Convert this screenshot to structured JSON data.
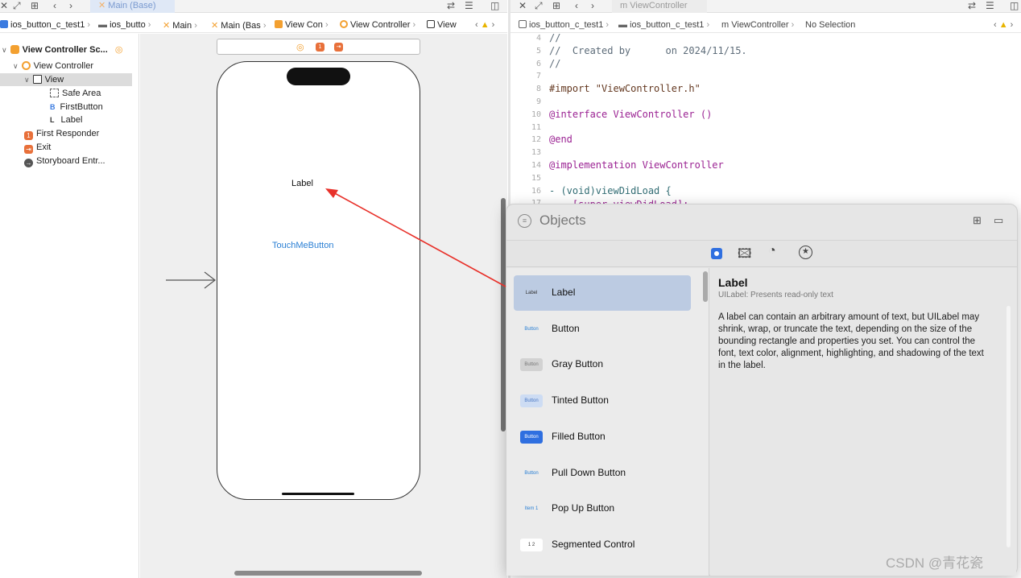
{
  "colors": {
    "selection": "#bccbe2",
    "link_blue": "#2a7fd4",
    "arrow_red": "#e8312a",
    "storyboard_orange": "#f0a030",
    "keyword": "#9b2393",
    "string": "#c41a16"
  },
  "left_tabbar": {
    "icons": [
      "close-icon",
      "expand-icon",
      "grid-icon",
      "back-icon",
      "forward-icon"
    ],
    "active_tab": "Main (Base)"
  },
  "right_tabbar": {
    "icons": [
      "close-icon",
      "expand-icon",
      "grid-icon",
      "back-icon",
      "forward-icon"
    ],
    "active_tab": "ViewController",
    "active_tab_prefix": "m"
  },
  "left_jumpbar": {
    "items": [
      "ios_button_c_test1",
      "ios_butto",
      "Main",
      "Main (Bas",
      "View Con",
      "View Controller",
      "View"
    ]
  },
  "right_jumpbar": {
    "items": [
      "ios_button_c_test1",
      "ios_button_c_test1",
      "ViewController",
      "No Selection"
    ],
    "file_prefix": "m"
  },
  "outline": {
    "scene": "View Controller Sc...",
    "controller": "View Controller",
    "view": "View",
    "safe_area": "Safe Area",
    "first_button": "FirstButton",
    "first_button_badge": "B",
    "label": "Label",
    "label_badge": "L",
    "first_responder": "First Responder",
    "exit": "Exit",
    "storyboard_entry": "Storyboard Entr..."
  },
  "canvas": {
    "label_text": "Label",
    "button_text": "TouchMeButton"
  },
  "editor": {
    "lines": [
      {
        "n": "4",
        "text": "//"
      },
      {
        "n": "5",
        "text": "//  Created by      on 2024/11/15."
      },
      {
        "n": "6",
        "text": "//"
      },
      {
        "n": "7",
        "text": ""
      },
      {
        "n": "8",
        "text": "#import \"ViewController.h\""
      },
      {
        "n": "9",
        "text": ""
      },
      {
        "n": "10",
        "text": "@interface ViewController ()"
      },
      {
        "n": "11",
        "text": ""
      },
      {
        "n": "12",
        "text": "@end"
      },
      {
        "n": "13",
        "text": ""
      },
      {
        "n": "14",
        "text": "@implementation ViewController"
      },
      {
        "n": "15",
        "text": ""
      },
      {
        "n": "16",
        "text": "- (void)viewDidLoad {"
      },
      {
        "n": "17",
        "text": "    [super viewDidLoad];"
      }
    ]
  },
  "library": {
    "title": "Objects",
    "filter_tabs": [
      "objects-icon",
      "image-icon",
      "palette-icon",
      "star-icon"
    ],
    "items": [
      {
        "label": "Label",
        "thumb": "Label"
      },
      {
        "label": "Button",
        "thumb": "Button"
      },
      {
        "label": "Gray Button",
        "thumb": "Button"
      },
      {
        "label": "Tinted Button",
        "thumb": "Button"
      },
      {
        "label": "Filled Button",
        "thumb": "Button"
      },
      {
        "label": "Pull Down Button",
        "thumb": "Button"
      },
      {
        "label": "Pop Up Button",
        "thumb": "Item 1"
      },
      {
        "label": "Segmented Control",
        "thumb": "1  2"
      }
    ],
    "detail": {
      "title": "Label",
      "subtitle": "UILabel: Presents read-only text",
      "body": "A label can contain an arbitrary amount of text, but UILabel may shrink, wrap, or truncate the text, depending on the size of the bounding rectangle and properties you set. You can control the font, text color, alignment, highlighting, and shadowing of the text in the label."
    }
  },
  "watermark": "CSDN @青花瓷"
}
